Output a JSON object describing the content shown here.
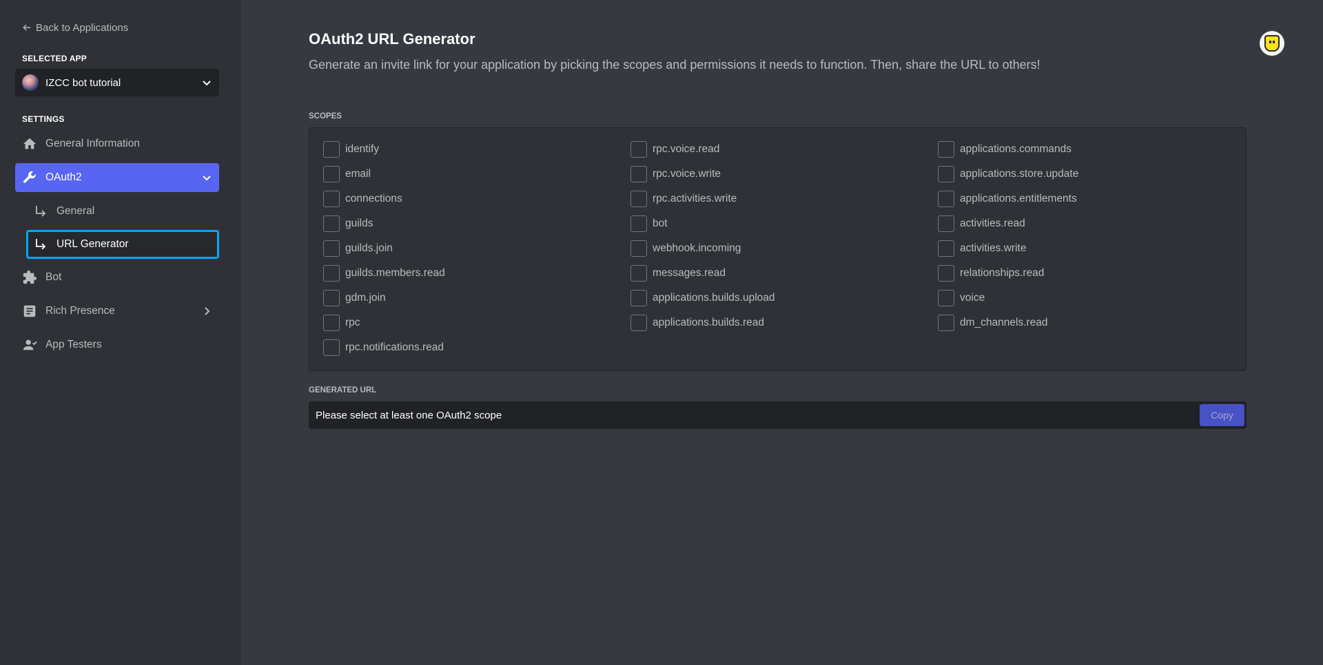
{
  "sidebar": {
    "back_label": "Back to Applications",
    "selected_app_label": "SELECTED APP",
    "app_name": "IZCC bot tutorial",
    "settings_label": "SETTINGS",
    "items": [
      {
        "label": "General Information",
        "icon": "home-icon"
      },
      {
        "label": "OAuth2",
        "icon": "wrench-icon",
        "active": true
      },
      {
        "label": "Bot",
        "icon": "puzzle-icon"
      },
      {
        "label": "Rich Presence",
        "icon": "document-icon"
      },
      {
        "label": "App Testers",
        "icon": "person-icon"
      }
    ],
    "subitems": [
      {
        "label": "General"
      },
      {
        "label": "URL Generator",
        "selected": true
      }
    ]
  },
  "main": {
    "title": "OAuth2 URL Generator",
    "description": "Generate an invite link for your application by picking the scopes and permissions it needs to function. Then, share the URL to others!",
    "scopes_label": "SCOPES",
    "scopes": [
      "identify",
      "rpc.voice.read",
      "applications.commands",
      "email",
      "rpc.voice.write",
      "applications.store.update",
      "connections",
      "rpc.activities.write",
      "applications.entitlements",
      "guilds",
      "bot",
      "activities.read",
      "guilds.join",
      "webhook.incoming",
      "activities.write",
      "guilds.members.read",
      "messages.read",
      "relationships.read",
      "gdm.join",
      "applications.builds.upload",
      "voice",
      "rpc",
      "applications.builds.read",
      "dm_channels.read",
      "rpc.notifications.read"
    ],
    "generated_url_label": "GENERATED URL",
    "generated_url_text": "Please select at least one OAuth2 scope",
    "copy_label": "Copy"
  },
  "colors": {
    "accent": "#5865f2",
    "selected_outline": "#00a8fc",
    "sidebar_bg": "#2f3136",
    "main_bg": "#36393f"
  }
}
